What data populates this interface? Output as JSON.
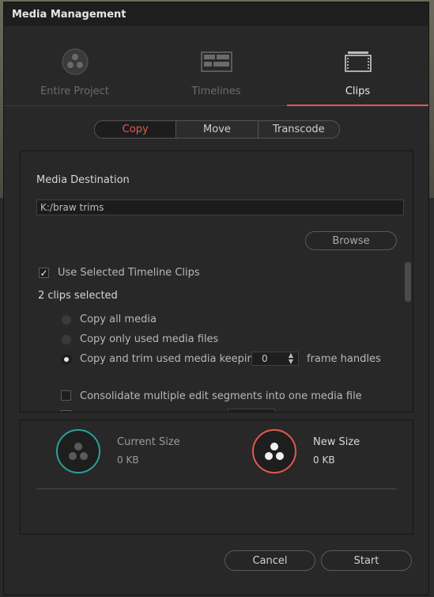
{
  "colors": {
    "accent": "#e15a52",
    "current_ring": "#2aa198",
    "new_ring": "#e15a52"
  },
  "window": {
    "title": "Media Management"
  },
  "tabs": [
    {
      "label": "Entire Project",
      "icon": "resolve-logo-icon",
      "active": false
    },
    {
      "label": "Timelines",
      "icon": "timeline-icon",
      "active": false
    },
    {
      "label": "Clips",
      "icon": "clips-icon",
      "active": true
    }
  ],
  "mode": {
    "options": [
      "Copy",
      "Move",
      "Transcode"
    ],
    "selected": "Copy"
  },
  "destination": {
    "label": "Media Destination",
    "path": "K:/braw trims",
    "browse_label": "Browse"
  },
  "options": {
    "use_selected_label": "Use Selected Timeline Clips",
    "use_selected_checked": true,
    "clips_selected": "2 clips selected",
    "radios": [
      {
        "label": "Copy all media",
        "checked": false
      },
      {
        "label": "Copy only used media files",
        "checked": false
      },
      {
        "label": "Copy and trim used media keeping",
        "checked": true
      }
    ],
    "handles_value": "0",
    "handles_suffix": "frame handles",
    "consolidate_label": "Consolidate multiple edit segments into one media file",
    "consolidate_checked": false
  },
  "sizes": {
    "current": {
      "label": "Current Size",
      "value": "0 KB"
    },
    "new": {
      "label": "New Size",
      "value": "0 KB"
    }
  },
  "footer": {
    "cancel_label": "Cancel",
    "start_label": "Start"
  }
}
